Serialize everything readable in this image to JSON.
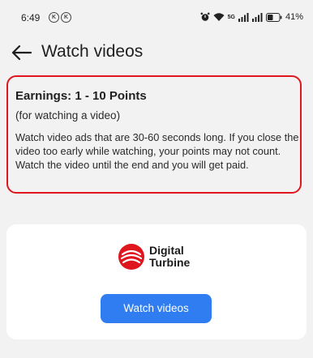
{
  "status_bar": {
    "time": "6:49",
    "notif_badges": [
      "K",
      "K"
    ],
    "data_icon_label": "5G",
    "battery_percent": "41%",
    "icons": [
      "alarm-icon",
      "wifi-icon",
      "data-icon",
      "signal-icon",
      "signal-icon",
      "battery-icon"
    ]
  },
  "header": {
    "title": "Watch videos",
    "back_icon": "arrow-left-icon"
  },
  "info": {
    "title": "Earnings: 1 - 10 Points",
    "subtitle": "(for watching a video)",
    "description": "Watch video ads that are 30-60 seconds long. If you close the video too early while watching, your points may not count. Watch the video until the end and you will get paid.",
    "highlight_color": "#e0161e"
  },
  "provider": {
    "logo_line1": "Digital",
    "logo_line2": "Turbine",
    "logo_color": "#e0161e",
    "button_label": "Watch videos",
    "button_color": "#2f7df0"
  }
}
